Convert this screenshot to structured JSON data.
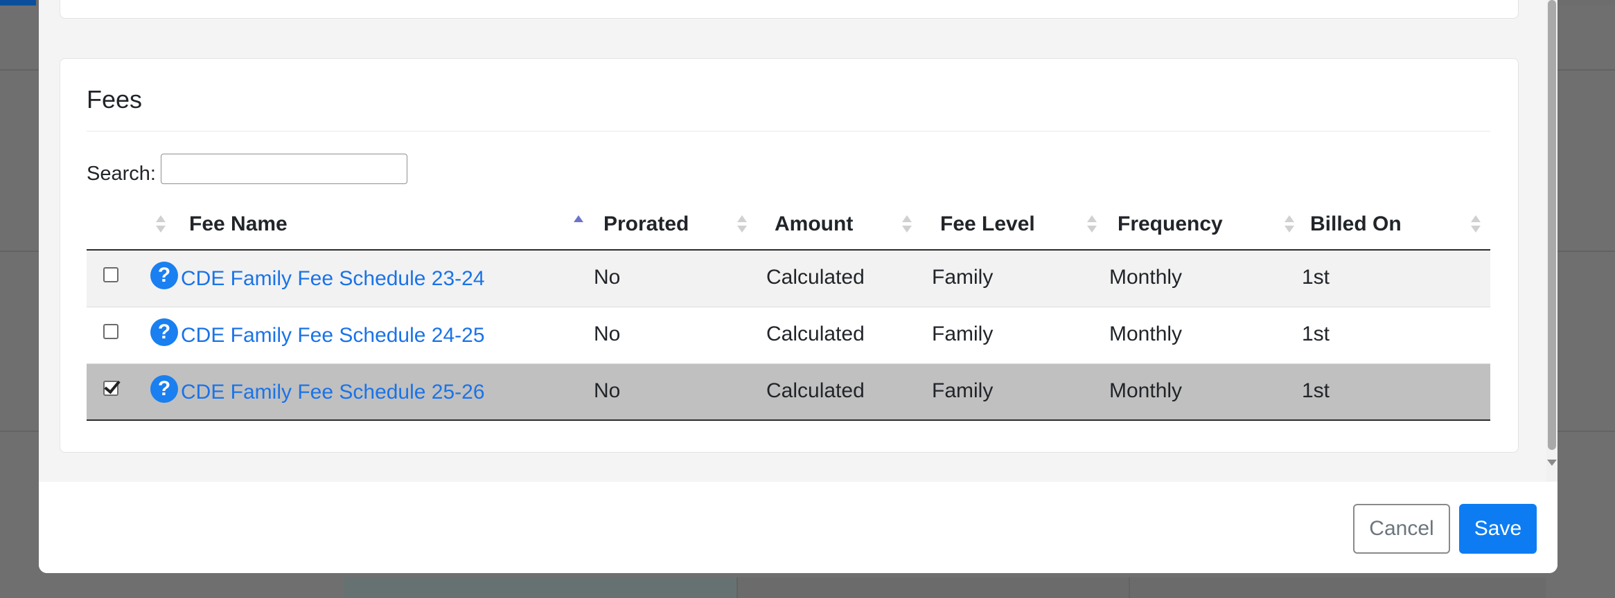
{
  "card": {
    "title": "Fees"
  },
  "search": {
    "label": "Search:",
    "value": "",
    "placeholder": ""
  },
  "table": {
    "columns": [
      {
        "label": ""
      },
      {
        "label": "Fee Name",
        "sorted": "ascending"
      },
      {
        "label": "Prorated"
      },
      {
        "label": "Amount"
      },
      {
        "label": "Fee Level"
      },
      {
        "label": "Frequency"
      },
      {
        "label": "Billed On"
      }
    ],
    "rows": [
      {
        "checked": false,
        "icon": "question-circle-icon",
        "fee_name": "CDE Family Fee Schedule 23-24",
        "prorated": "No",
        "amount": "Calculated",
        "fee_level": "Family",
        "frequency": "Monthly",
        "billed_on": "1st"
      },
      {
        "checked": false,
        "icon": "question-circle-icon",
        "fee_name": "CDE Family Fee Schedule 24-25",
        "prorated": "No",
        "amount": "Calculated",
        "fee_level": "Family",
        "frequency": "Monthly",
        "billed_on": "1st"
      },
      {
        "checked": true,
        "icon": "question-circle-icon",
        "fee_name": "CDE Family Fee Schedule 25-26",
        "prorated": "No",
        "amount": "Calculated",
        "fee_level": "Family",
        "frequency": "Monthly",
        "billed_on": "1st"
      }
    ]
  },
  "footer": {
    "cancel_label": "Cancel",
    "save_label": "Save"
  },
  "colors": {
    "primary": "#0d7cf2",
    "link": "#1a73e8",
    "selected_row": "#c0c0c0",
    "sort_active": "#6c74c9"
  }
}
